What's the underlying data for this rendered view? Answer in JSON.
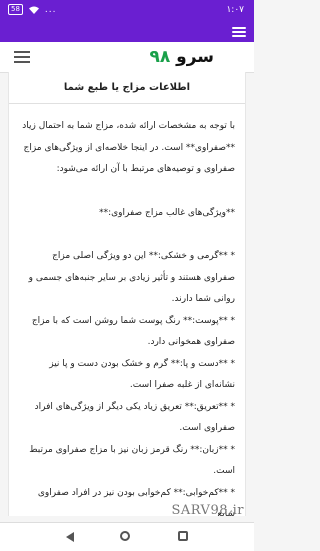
{
  "status": {
    "time": "۱:۰۷",
    "battery": "58",
    "overflow": "..."
  },
  "header": {
    "logo_text": "سرو",
    "logo_num": "۹۸"
  },
  "article": {
    "title": "اطلاعات مزاج یا طبع شما",
    "paragraphs": [
      "با توجه به مشخصات ارائه شده، مزاج شما به احتمال زیاد **صفراوی** است. در اینجا خلاصه‌ای از ویژگی‌های مزاج صفراوی و توصیه‌های مرتبط با آن ارائه می‌شود:",
      "**ویژگی‌های غالب مزاج صفراوی:**",
      "* **گرمی و خشکی:** این دو ویژگی اصلی مزاج صفراوی هستند و تأثیر زیادی بر سایر جنبه‌های جسمی و روانی شما دارند.",
      "* **پوست:** رنگ پوست شما روشن است که با مزاج صفراوی همخوانی دارد.",
      "* **دست و پا:** گرم و خشک بودن دست و پا نیز نشانه‌ای از غلبه صفرا است.",
      "* **تعریق:** تعریق زیاد یکی دیگر از ویژگی‌های افراد صفراوی است.",
      "* **زبان:** رنگ قرمز زبان نیز با مزاج صفراوی مرتبط است.",
      "* **کم‌خوابی:** کم‌خوابی بودن نیز در افراد صفراوی شایع"
    ]
  },
  "watermark": "SARV98.ir",
  "colors": {
    "app_bar": "#6a1fd1",
    "logo_accent": "#19a04a"
  },
  "icons": {
    "menu": "hamburger-icon",
    "back": "back-triangle-icon",
    "home": "home-circle-icon",
    "recent": "recent-square-icon"
  }
}
